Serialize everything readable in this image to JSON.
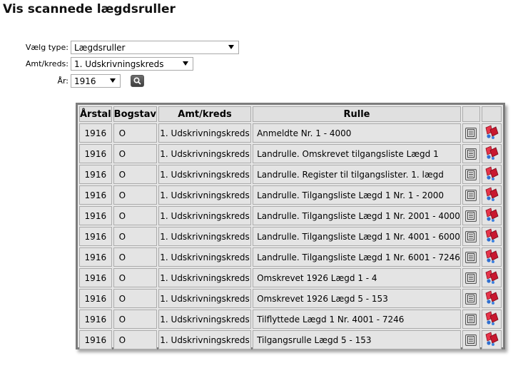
{
  "page": {
    "title": "Vis scannede lægdsruller"
  },
  "filters": {
    "type": {
      "label": "Vælg type:",
      "value": "Lægdsruller"
    },
    "amt": {
      "label": "Amt/kreds:",
      "value": "1. Udskrivningskreds"
    },
    "year": {
      "label": "År:",
      "value": "1916"
    },
    "search_icon": "magnifier-icon"
  },
  "table": {
    "headers": {
      "year": "Årstal",
      "letter": "Bogstav",
      "amt": "Amt/kreds",
      "rulle": "Rulle",
      "view": "",
      "download": ""
    },
    "rows": [
      {
        "year": "1916",
        "letter": "O",
        "amt": "1. Udskrivningskreds",
        "rulle": "Anmeldte Nr. 1 - 4000"
      },
      {
        "year": "1916",
        "letter": "O",
        "amt": "1. Udskrivningskreds",
        "rulle": "Landrulle. Omskrevet tilgangsliste Lægd 1"
      },
      {
        "year": "1916",
        "letter": "O",
        "amt": "1. Udskrivningskreds",
        "rulle": "Landrulle. Register til tilgangslister. 1. lægd"
      },
      {
        "year": "1916",
        "letter": "O",
        "amt": "1. Udskrivningskreds",
        "rulle": "Landrulle. Tilgangsliste Lægd 1 Nr. 1 - 2000"
      },
      {
        "year": "1916",
        "letter": "O",
        "amt": "1. Udskrivningskreds",
        "rulle": "Landrulle. Tilgangsliste Lægd 1 Nr. 2001 - 4000"
      },
      {
        "year": "1916",
        "letter": "O",
        "amt": "1. Udskrivningskreds",
        "rulle": "Landrulle. Tilgangsliste Lægd 1 Nr. 4001 - 6000"
      },
      {
        "year": "1916",
        "letter": "O",
        "amt": "1. Udskrivningskreds",
        "rulle": "Landrulle. Tilgangsliste Lægd 1 Nr. 6001 - 7246"
      },
      {
        "year": "1916",
        "letter": "O",
        "amt": "1. Udskrivningskreds",
        "rulle": "Omskrevet 1926 Lægd 1 - 4"
      },
      {
        "year": "1916",
        "letter": "O",
        "amt": "1. Udskrivningskreds",
        "rulle": "Omskrevet 1926 Lægd 5 - 153"
      },
      {
        "year": "1916",
        "letter": "O",
        "amt": "1. Udskrivningskreds",
        "rulle": "Tilflyttede Lægd 1 Nr. 4001 - 7246"
      },
      {
        "year": "1916",
        "letter": "O",
        "amt": "1. Udskrivningskreds",
        "rulle": "Tilgangsrulle Lægd 5 - 153"
      }
    ],
    "row_icons": {
      "view": "document-icon",
      "download": "red-flags-icon"
    }
  }
}
